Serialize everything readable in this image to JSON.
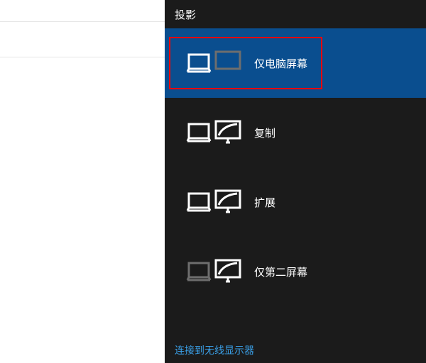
{
  "panel": {
    "title": "投影",
    "options": [
      {
        "label": "仅电脑屏幕"
      },
      {
        "label": "复制"
      },
      {
        "label": "扩展"
      },
      {
        "label": "仅第二屏幕"
      }
    ],
    "footer_link": "连接到无线显示器"
  },
  "colors": {
    "panel_bg": "#1b1b1b",
    "selected_bg": "#0a4e8f",
    "link": "#3aa0e8",
    "highlight": "#ff0000",
    "dim_stroke": "#6e6e6e"
  }
}
